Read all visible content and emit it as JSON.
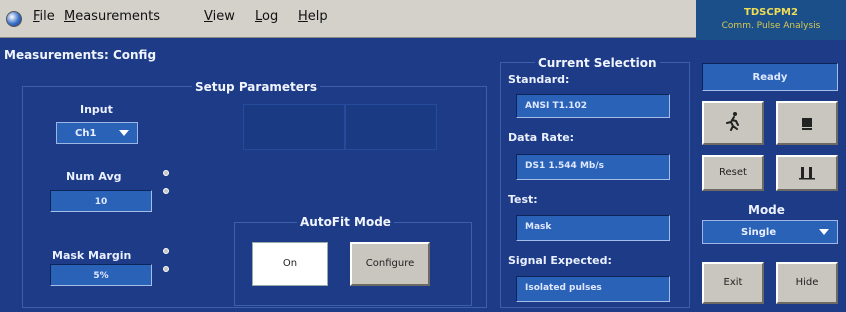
{
  "menubar": {
    "items": [
      {
        "pre": "",
        "ul": "F",
        "rest": "ile"
      },
      {
        "pre": "",
        "ul": "M",
        "rest": "easurements"
      },
      {
        "pre": "",
        "ul": "V",
        "rest": "iew"
      },
      {
        "pre": "",
        "ul": "L",
        "rest": "og"
      },
      {
        "pre": "",
        "ul": "H",
        "rest": "elp"
      }
    ]
  },
  "brand": {
    "title": "TDSCPM2",
    "subtitle": "Comm. Pulse Analysis"
  },
  "page_title": "Measurements: Config",
  "setup": {
    "header": "Setup Parameters",
    "input_label": "Input",
    "input_value": "Ch1",
    "num_avg_label": "Num Avg",
    "num_avg_value": "10",
    "mask_margin_label": "Mask Margin",
    "mask_margin_value": "5%"
  },
  "autofit": {
    "header": "AutoFit Mode",
    "on_label": "On",
    "configure_label": "Configure"
  },
  "current_selection": {
    "header": "Current Selection",
    "standard_label": "Standard:",
    "standard_value": "ANSI T1.102",
    "data_rate_label": "Data Rate:",
    "data_rate_value": "DS1 1.544 Mb/s",
    "test_label": "Test:",
    "test_value": "Mask",
    "signal_label": "Signal Expected:",
    "signal_value": "Isolated pulses"
  },
  "right_panel": {
    "status": "Ready",
    "reset_label": "Reset",
    "mode_label": "Mode",
    "mode_value": "Single",
    "exit_label": "Exit",
    "hide_label": "Hide"
  }
}
